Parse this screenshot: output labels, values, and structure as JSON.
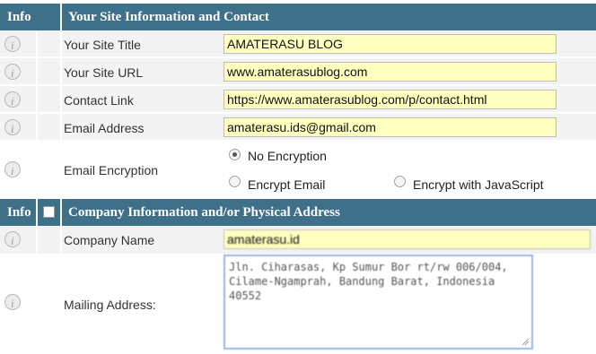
{
  "section1": {
    "info_label": "Info",
    "title": "Your Site Information and Contact",
    "rows": [
      {
        "label": "Your Site Title",
        "value": "AMATERASU BLOG"
      },
      {
        "label": "Your Site URL",
        "value": "www.amaterasublog.com"
      },
      {
        "label": "Contact Link",
        "value": "https://www.amaterasublog.com/p/contact.html"
      },
      {
        "label": "Email Address",
        "value": "amaterasu.ids@gmail.com"
      }
    ],
    "encryption": {
      "label": "Email Encryption",
      "options": [
        "No Encryption",
        "Encrypt Email",
        "Encrypt with JavaScript"
      ],
      "selected": "No Encryption"
    }
  },
  "section2": {
    "info_label": "Info",
    "title": "Company Information and/or Physical Address",
    "company_label": "Company Name",
    "company_value": "amaterasu.id",
    "mailing_label": "Mailing Address:",
    "mailing_value": "Jln. Ciharasas, Kp Sumur Bor rt/rw 006/004, Cilame-Ngamprah, Bandung Barat, Indonesia 40552"
  },
  "colors": {
    "header": "#3f7089",
    "field": "#ffffc0",
    "row": "#f3f3f3"
  },
  "icons": {
    "info": "info-icon",
    "grip": "resize-grip-icon"
  }
}
